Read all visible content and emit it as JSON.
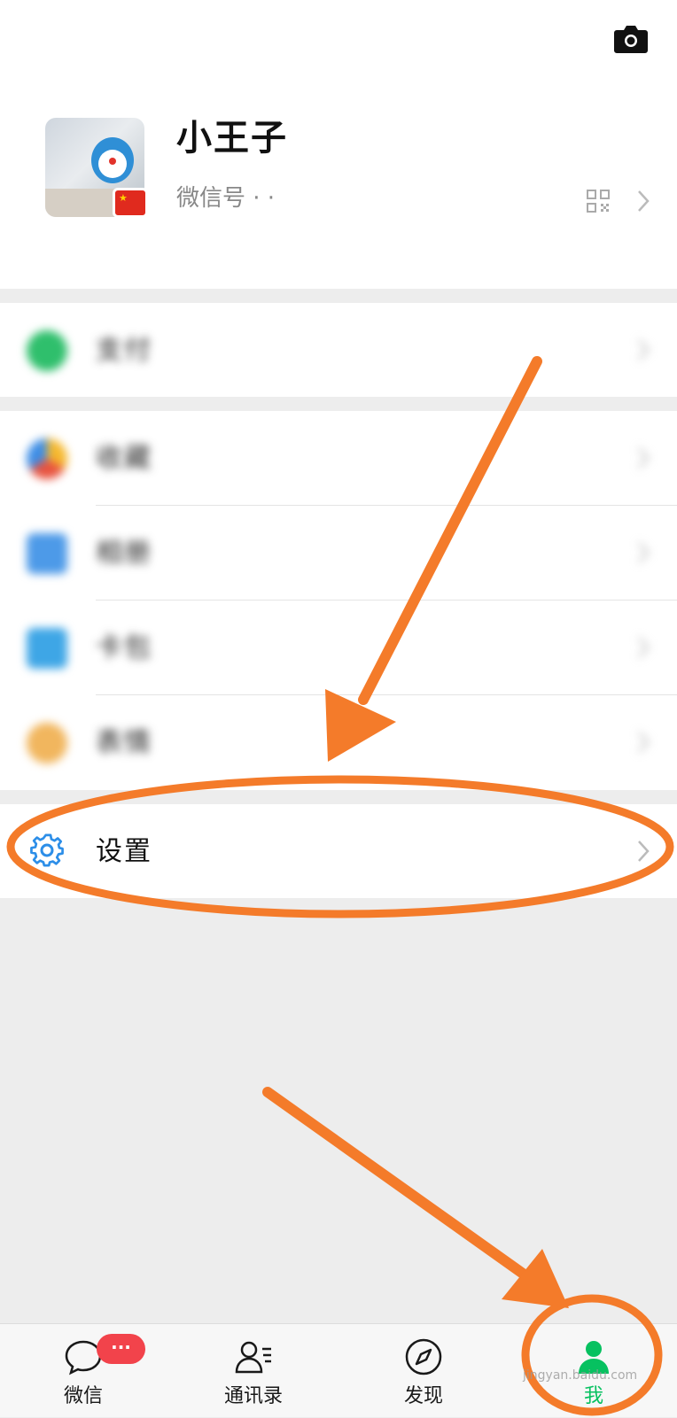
{
  "profile": {
    "name": "小王子",
    "wechat_id_label": "微信号 · ·",
    "camera_icon": "camera-icon",
    "qr_icon": "qr-code-icon",
    "flag_icon": "china-flag-icon"
  },
  "menu": {
    "pay": {
      "label": "支付",
      "icon": "pay-icon"
    },
    "group2": [
      {
        "label": "收藏",
        "icon": "favorites-icon"
      },
      {
        "label": "相册",
        "icon": "album-icon"
      },
      {
        "label": "卡包",
        "icon": "card-wallet-icon"
      },
      {
        "label": "表情",
        "icon": "sticker-icon"
      }
    ],
    "settings": {
      "label": "设置",
      "icon": "gear-icon"
    }
  },
  "tabbar": {
    "tabs": [
      {
        "label": "微信",
        "icon": "chat-icon",
        "active": false
      },
      {
        "label": "通讯录",
        "icon": "contacts-icon",
        "active": false
      },
      {
        "label": "发现",
        "icon": "discover-icon",
        "active": false
      },
      {
        "label": "我",
        "icon": "me-icon",
        "active": true
      }
    ],
    "badge": "···"
  },
  "colors": {
    "accent_green": "#07c160",
    "annotation_orange": "#f47b2a",
    "badge_red": "#f2434b"
  },
  "watermark": "jingyan.baidu.com"
}
